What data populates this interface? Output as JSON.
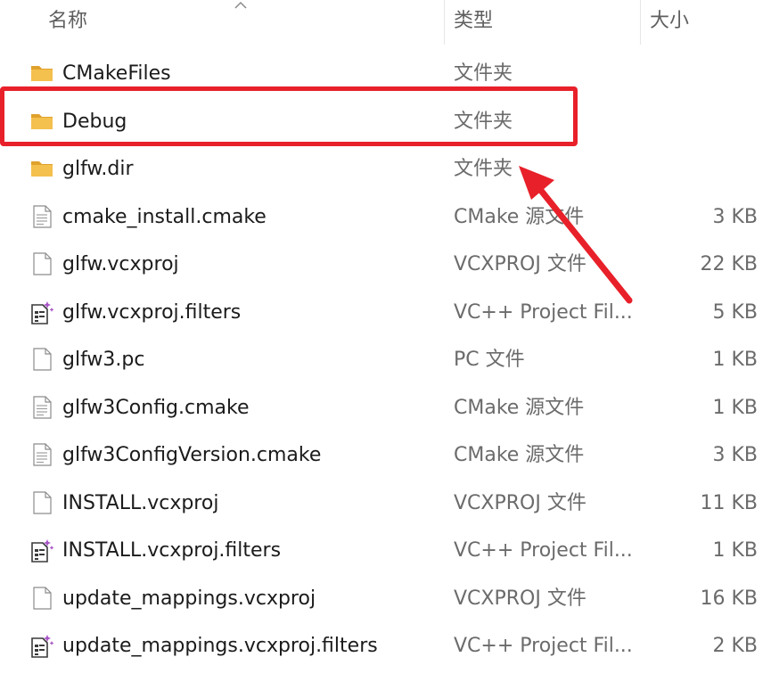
{
  "header": {
    "name": "名称",
    "type": "类型",
    "size": "大小"
  },
  "files": [
    {
      "name": "CMakeFiles",
      "type": "文件夹",
      "size": "",
      "icon": "folder-icon"
    },
    {
      "name": "Debug",
      "type": "文件夹",
      "size": "",
      "icon": "folder-icon"
    },
    {
      "name": "glfw.dir",
      "type": "文件夹",
      "size": "",
      "icon": "folder-icon"
    },
    {
      "name": "cmake_install.cmake",
      "type": "CMake 源文件",
      "size": "3 KB",
      "icon": "text-file-icon"
    },
    {
      "name": "glfw.vcxproj",
      "type": "VCXPROJ 文件",
      "size": "22 KB",
      "icon": "blank-file-icon"
    },
    {
      "name": "glfw.vcxproj.filters",
      "type": "VC++ Project Fil...",
      "size": "5 KB",
      "icon": "vc-filters-icon"
    },
    {
      "name": "glfw3.pc",
      "type": "PC 文件",
      "size": "1 KB",
      "icon": "blank-file-icon"
    },
    {
      "name": "glfw3Config.cmake",
      "type": "CMake 源文件",
      "size": "1 KB",
      "icon": "text-file-icon"
    },
    {
      "name": "glfw3ConfigVersion.cmake",
      "type": "CMake 源文件",
      "size": "3 KB",
      "icon": "text-file-icon"
    },
    {
      "name": "INSTALL.vcxproj",
      "type": "VCXPROJ 文件",
      "size": "11 KB",
      "icon": "blank-file-icon"
    },
    {
      "name": "INSTALL.vcxproj.filters",
      "type": "VC++ Project Fil...",
      "size": "1 KB",
      "icon": "vc-filters-icon"
    },
    {
      "name": "update_mappings.vcxproj",
      "type": "VCXPROJ 文件",
      "size": "16 KB",
      "icon": "blank-file-icon"
    },
    {
      "name": "update_mappings.vcxproj.filters",
      "type": "VC++ Project Fil...",
      "size": "2 KB",
      "icon": "vc-filters-icon"
    }
  ],
  "colors": {
    "highlight": "#e8202a",
    "folder": "#f4c04e",
    "folder_dark": "#e0a22c"
  }
}
